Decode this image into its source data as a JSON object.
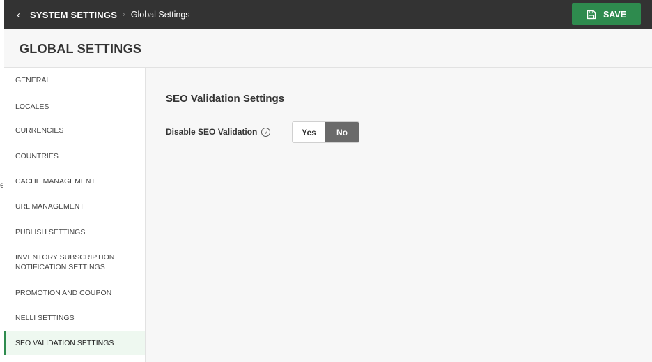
{
  "topbar": {
    "back_icon": "chevron-left-icon",
    "breadcrumb_root": "SYSTEM SETTINGS",
    "breadcrumb_separator": "›",
    "breadcrumb_current": "Global Settings",
    "save_label": "SAVE",
    "save_icon": "floppy-disk-icon",
    "save_color": "#2e8b4e",
    "bar_color": "#333333"
  },
  "header": {
    "title": "GLOBAL SETTINGS"
  },
  "sidebar": {
    "items": [
      {
        "label": "GENERAL"
      },
      {
        "label": "LOCALES"
      },
      {
        "label": "CURRENCIES"
      },
      {
        "label": "COUNTRIES"
      },
      {
        "label": "CACHE MANAGEMENT"
      },
      {
        "label": "URL MANAGEMENT"
      },
      {
        "label": "PUBLISH SETTINGS"
      },
      {
        "label": "INVENTORY SUBSCRIPTION",
        "label2": "NOTIFICATION SETTINGS"
      },
      {
        "label": "PROMOTION AND COUPON"
      },
      {
        "label": "NELLI SETTINGS"
      },
      {
        "label": "SEO VALIDATION SETTINGS",
        "active": true
      }
    ],
    "active_color": "#2e8b4e"
  },
  "main": {
    "section_title": "SEO Validation Settings",
    "field": {
      "label": "Disable SEO Validation",
      "help_icon": "question-circle-icon",
      "help_glyph": "?",
      "options": [
        "Yes",
        "No"
      ],
      "selected": "No"
    }
  }
}
